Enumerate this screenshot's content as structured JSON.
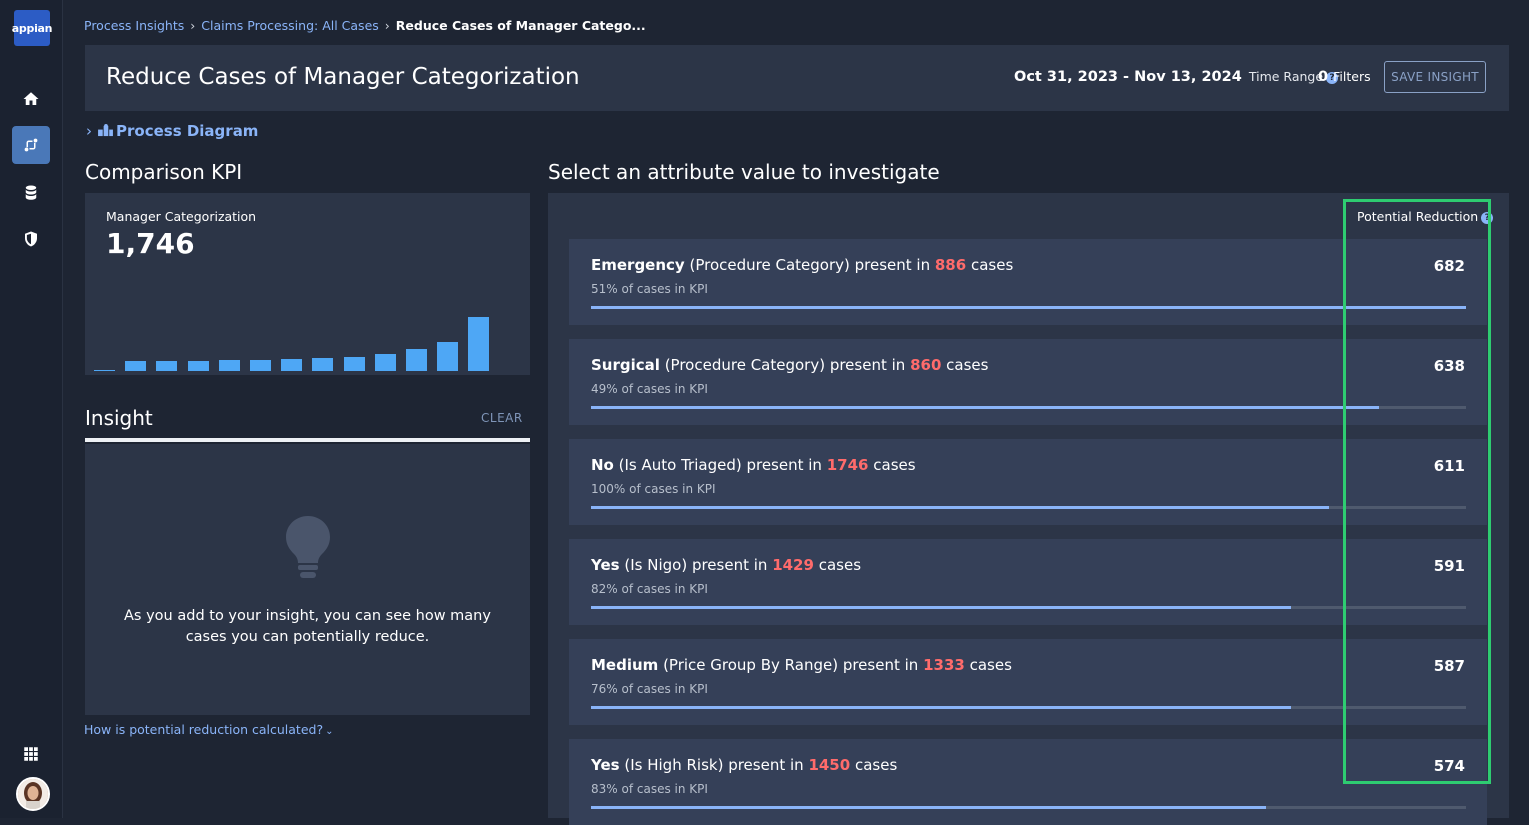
{
  "rail": {
    "logo_text": "appian",
    "icons": [
      "home-icon",
      "process-icon",
      "database-icon",
      "shield-icon",
      "apps-grid-icon"
    ]
  },
  "breadcrumb": {
    "items": [
      "Process Insights",
      "Claims Processing: All Cases",
      "Reduce Cases of Manager Catego..."
    ]
  },
  "header": {
    "title": "Reduce Cases of Manager Categorization",
    "date_range": "Oct 31, 2023 - Nov 13, 2024",
    "time_range_label": "Time Range",
    "filters_count": "0",
    "filters_label": "Filters",
    "save_label": "SAVE INSIGHT"
  },
  "process_diagram_label": "Process Diagram",
  "kpi": {
    "section_title": "Comparison KPI",
    "label": "Manager Categorization",
    "value": "1,746",
    "spark_values": [
      1,
      8,
      8,
      8,
      9,
      9,
      10,
      11,
      12,
      14,
      18,
      24,
      45
    ]
  },
  "insight": {
    "title": "Insight",
    "clear_label": "CLEAR",
    "empty_text": "As you add to your insight, you can see how many cases you can potentially reduce.",
    "help_link": "How is potential reduction calculated?"
  },
  "attributes": {
    "section_title": "Select an attribute value to investigate",
    "potential_reduction_label": "Potential Reduction",
    "rows": [
      {
        "value": "Emergency",
        "attr": "(Procedure Category) present in",
        "count": "886",
        "suffix": "cases",
        "pct_text": "51% of cases in KPI",
        "reduction": "682",
        "bar": 1.0
      },
      {
        "value": "Surgical",
        "attr": "(Procedure Category) present in",
        "count": "860",
        "suffix": "cases",
        "pct_text": "49% of cases in KPI",
        "reduction": "638",
        "bar": 0.9
      },
      {
        "value": "No",
        "attr": "(Is Auto Triaged) present in",
        "count": "1746",
        "suffix": "cases",
        "pct_text": "100% of cases in KPI",
        "reduction": "611",
        "bar": 0.843
      },
      {
        "value": "Yes",
        "attr": "(Is Nigo) present in",
        "count": "1429",
        "suffix": "cases",
        "pct_text": "82% of cases in KPI",
        "reduction": "591",
        "bar": 0.8
      },
      {
        "value": "Medium",
        "attr": "(Price Group By Range) present in",
        "count": "1333",
        "suffix": "cases",
        "pct_text": "76% of cases in KPI",
        "reduction": "587",
        "bar": 0.8
      },
      {
        "value": "Yes",
        "attr": "(Is High Risk) present in",
        "count": "1450",
        "suffix": "cases",
        "pct_text": "83% of cases in KPI",
        "reduction": "574",
        "bar": 0.771
      }
    ]
  }
}
